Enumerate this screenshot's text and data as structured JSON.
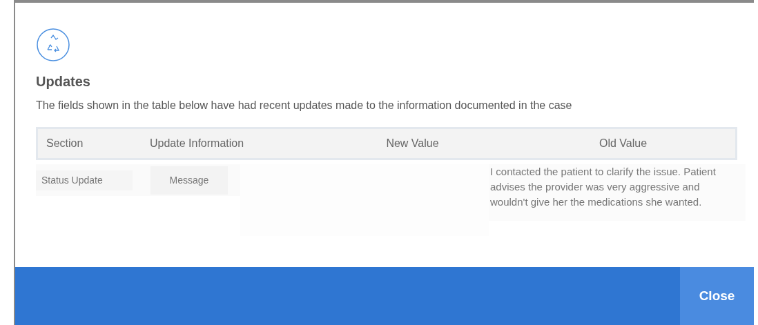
{
  "dialog": {
    "title": "Updates",
    "description": "The fields shown in the table below have had recent updates made to the information documented in the case"
  },
  "table": {
    "columns": [
      "Section",
      "Update Information",
      "New Value",
      "Old Value"
    ],
    "rows": [
      {
        "section": "Status Update",
        "update_information": "Message",
        "old_value": "I contacted the patient to clarify the issue. Patient advises the provider was very aggressive and wouldn't give her the medications she wanted."
      }
    ]
  },
  "footer": {
    "button": "Close"
  }
}
